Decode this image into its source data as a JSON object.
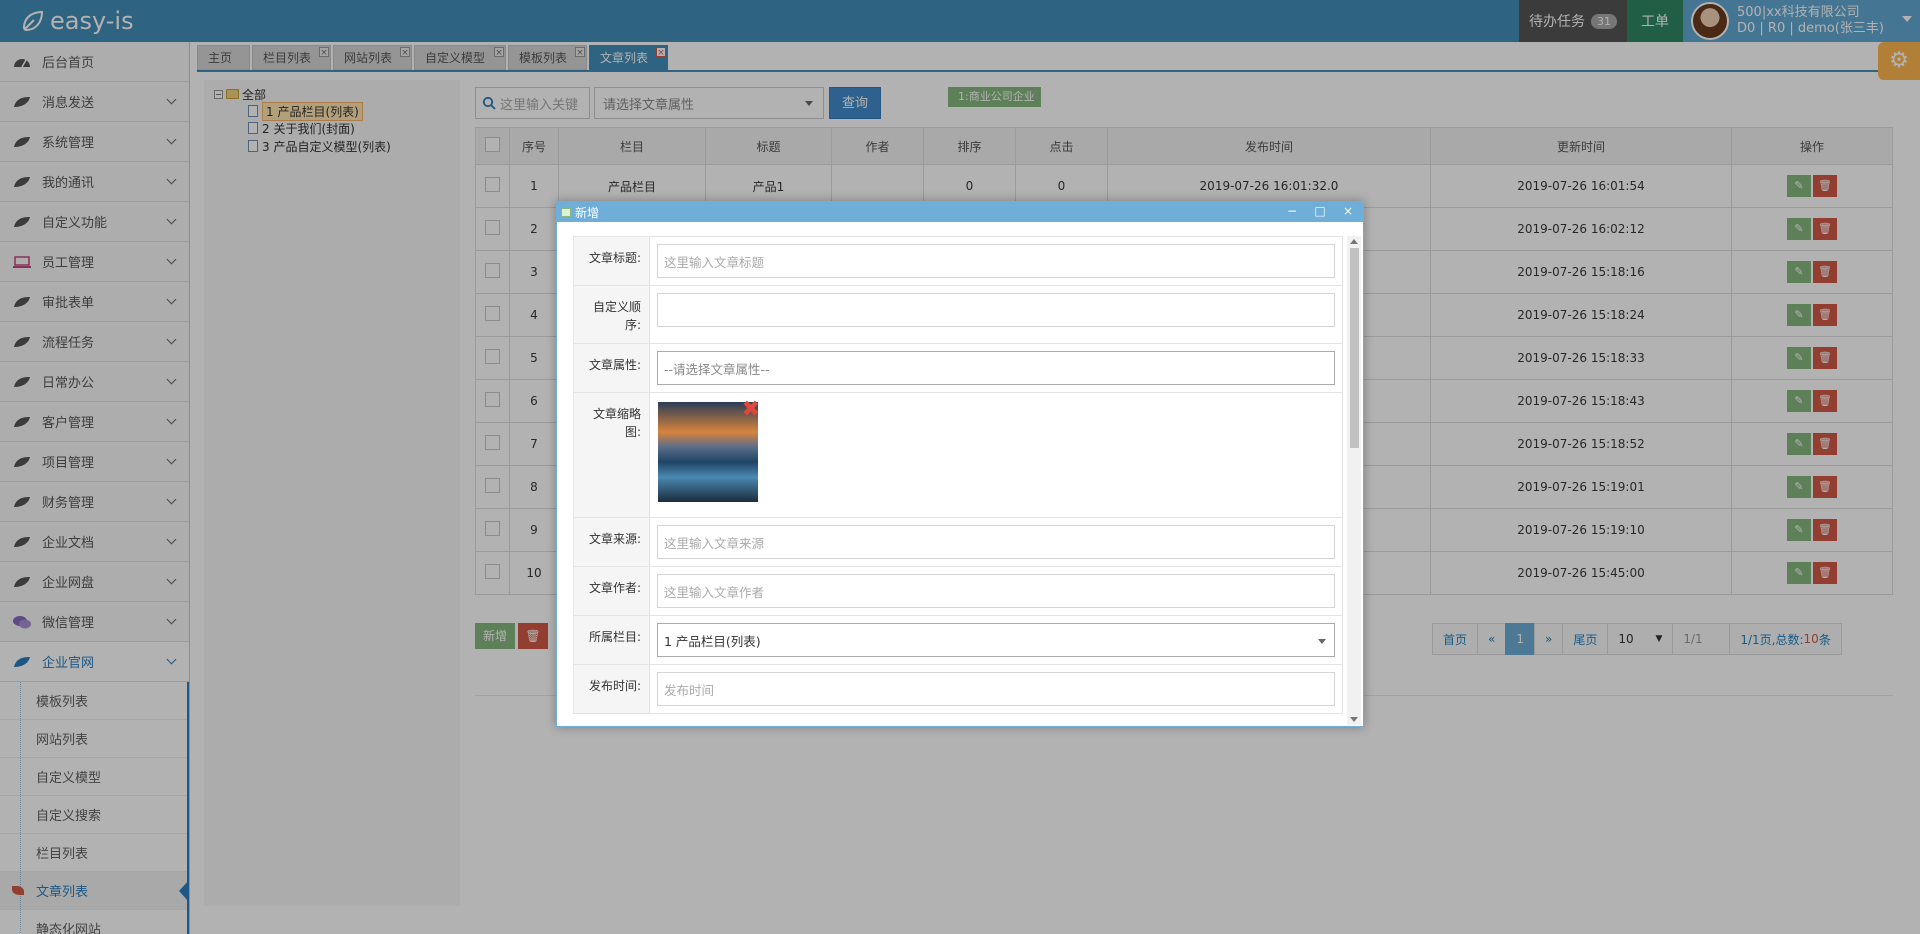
{
  "header": {
    "brand": "easy-is",
    "tasks_label": "待办任务",
    "tasks_count": "31",
    "ticket_label": "工单",
    "user_line1": "500|xx科技有限公司",
    "user_line2": "D0 | R0 | demo(张三丰)"
  },
  "sidebar": {
    "items": [
      {
        "label": "后台首页",
        "icon": "dashboard-icon"
      },
      {
        "label": "消息发送",
        "icon": "leaf-icon"
      },
      {
        "label": "系统管理",
        "icon": "leaf-icon"
      },
      {
        "label": "我的通讯",
        "icon": "leaf-icon"
      },
      {
        "label": "自定义功能",
        "icon": "leaf-icon"
      },
      {
        "label": "员工管理",
        "icon": "laptop-icon"
      },
      {
        "label": "审批表单",
        "icon": "leaf-icon"
      },
      {
        "label": "流程任务",
        "icon": "leaf-icon"
      },
      {
        "label": "日常办公",
        "icon": "leaf-icon"
      },
      {
        "label": "客户管理",
        "icon": "leaf-icon"
      },
      {
        "label": "项目管理",
        "icon": "leaf-icon"
      },
      {
        "label": "财务管理",
        "icon": "leaf-icon"
      },
      {
        "label": "企业文档",
        "icon": "leaf-icon"
      },
      {
        "label": "企业网盘",
        "icon": "leaf-icon"
      },
      {
        "label": "微信管理",
        "icon": "chat-icon"
      },
      {
        "label": "企业官网",
        "icon": "leaf-icon"
      }
    ],
    "sub_items": [
      "模板列表",
      "网站列表",
      "自定义模型",
      "自定义搜索",
      "栏目列表",
      "文章列表",
      "静态化网站"
    ]
  },
  "tabs": [
    "主页",
    "栏目列表",
    "网站列表",
    "自定义模型",
    "模板列表",
    "文章列表"
  ],
  "tree": {
    "root": "全部",
    "nodes": [
      "1 产品栏目(列表)",
      "2 关于我们(封面)",
      "3 产品自定义模型(列表)"
    ]
  },
  "toolbar": {
    "search_placeholder": "这里输入关键",
    "attr_placeholder": "请选择文章属性",
    "query_label": "查询",
    "tag_label": "1:商业公司企业"
  },
  "table": {
    "headers": [
      "序号",
      "栏目",
      "标题",
      "作者",
      "排序",
      "点击",
      "发布时间",
      "更新时间",
      "操作"
    ],
    "rows": [
      {
        "no": "1",
        "column": "产品栏目",
        "title": "产品1",
        "author": "",
        "sort": "0",
        "clicks": "0",
        "published": "2019-07-26 16:01:32.0",
        "updated": "2019-07-26 16:01:54"
      },
      {
        "no": "2",
        "column": "",
        "title": "",
        "author": "",
        "sort": "",
        "clicks": "",
        "published": "",
        "updated": "2019-07-26 16:02:12"
      },
      {
        "no": "3",
        "column": "",
        "title": "",
        "author": "",
        "sort": "",
        "clicks": "",
        "published": "",
        "updated": "2019-07-26 15:18:16"
      },
      {
        "no": "4",
        "column": "",
        "title": "",
        "author": "",
        "sort": "",
        "clicks": "",
        "published": "",
        "updated": "2019-07-26 15:18:24"
      },
      {
        "no": "5",
        "column": "",
        "title": "",
        "author": "",
        "sort": "",
        "clicks": "",
        "published": "",
        "updated": "2019-07-26 15:18:33"
      },
      {
        "no": "6",
        "column": "",
        "title": "",
        "author": "",
        "sort": "",
        "clicks": "",
        "published": "",
        "updated": "2019-07-26 15:18:43"
      },
      {
        "no": "7",
        "column": "",
        "title": "",
        "author": "",
        "sort": "",
        "clicks": "",
        "published": "",
        "updated": "2019-07-26 15:18:52"
      },
      {
        "no": "8",
        "column": "",
        "title": "",
        "author": "",
        "sort": "",
        "clicks": "",
        "published": "",
        "updated": "2019-07-26 15:19:01"
      },
      {
        "no": "9",
        "column": "",
        "title": "",
        "author": "",
        "sort": "",
        "clicks": "",
        "published": "",
        "updated": "2019-07-26 15:19:10"
      },
      {
        "no": "10",
        "column": "",
        "title": "",
        "author": "",
        "sort": "",
        "clicks": "",
        "published": "",
        "updated": "2019-07-26 15:45:00"
      }
    ]
  },
  "actions": {
    "add_label": "新增",
    "delete_icon": "trash-icon"
  },
  "pager": {
    "first": "首页",
    "prev": "«",
    "current": "1",
    "next": "»",
    "last": "尾页",
    "page_size": "10",
    "page_input": "1/1",
    "info_prefix": "1/1页,总数:",
    "info_count": "10",
    "info_suffix": "条"
  },
  "dialog": {
    "title": "新增",
    "fields": {
      "title_label": "文章标题:",
      "title_placeholder": "这里输入文章标题",
      "order_label": "自定义顺序:",
      "attr_label": "文章属性:",
      "attr_placeholder": "--请选择文章属性--",
      "thumb_label": "文章缩略图:",
      "source_label": "文章来源:",
      "source_placeholder": "这里输入文章来源",
      "author_label": "文章作者:",
      "author_placeholder": "这里输入文章作者",
      "column_label": "所属栏目:",
      "column_value": "1 产品栏目(列表)",
      "publish_label": "发布时间:",
      "publish_placeholder": "发布时间"
    }
  },
  "colors": {
    "navbar": "#438eb9",
    "primary": "#428bca",
    "success": "#87b87f",
    "danger": "#d15b47",
    "warning": "#ffb752"
  }
}
